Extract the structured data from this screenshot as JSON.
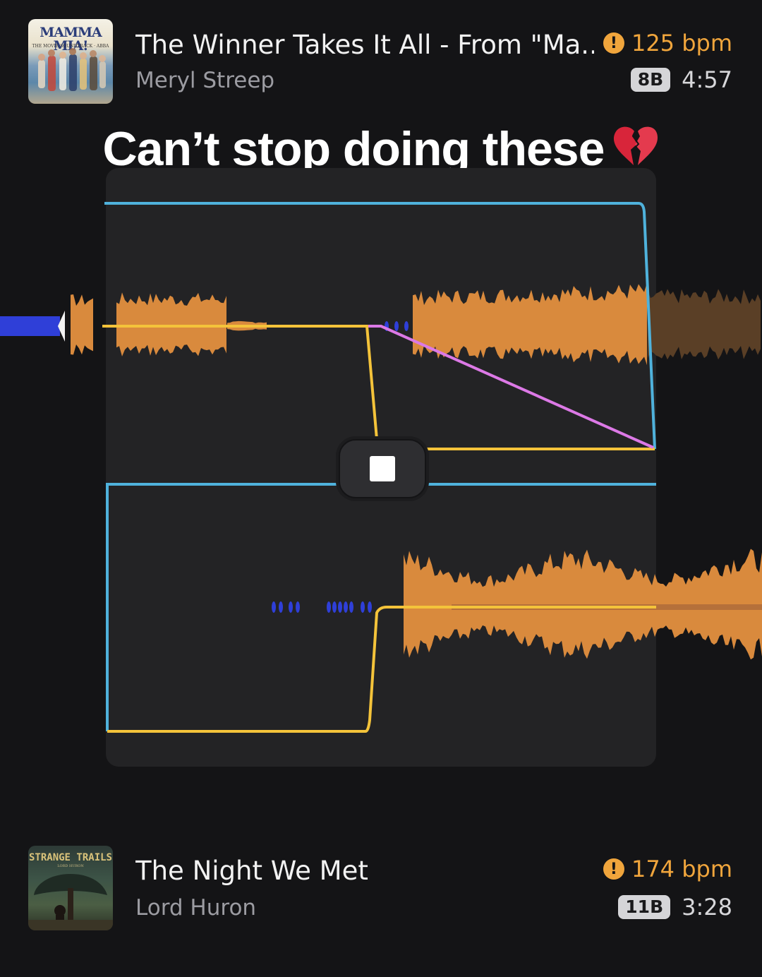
{
  "track1": {
    "title": "The Winner Takes It All - From \"Ma...",
    "artist": "Meryl Streep",
    "bpm": "125 bpm",
    "key": "8B",
    "duration": "4:57",
    "art_text": "MAMMA MIA!",
    "art_subtext": "THE MOVIE SOUNDTRACK · ABBA"
  },
  "caption": "Can’t stop doing these",
  "caption_emoji_icon": "broken-heart-icon",
  "track2": {
    "title": "The Night We Met",
    "artist": "Lord Huron",
    "bpm": "174 bpm",
    "key": "11B",
    "duration": "3:28",
    "art_text": "STRANGE TRAILS",
    "art_subtext": "LORD HURON"
  },
  "warning_symbol": "!",
  "colors": {
    "waveform": "#d98a3d",
    "waveform_dim": "#5a3f26",
    "low_band": "#2f3fd8",
    "volume_curve": "#4fb2dc",
    "eq_curve": "#f4c33a",
    "filter_curve": "#dc79e6",
    "bpm_warning": "#f0a53c",
    "background": "#141416",
    "panel": "#232325"
  },
  "controls": {
    "stop_icon": "stop-icon"
  }
}
